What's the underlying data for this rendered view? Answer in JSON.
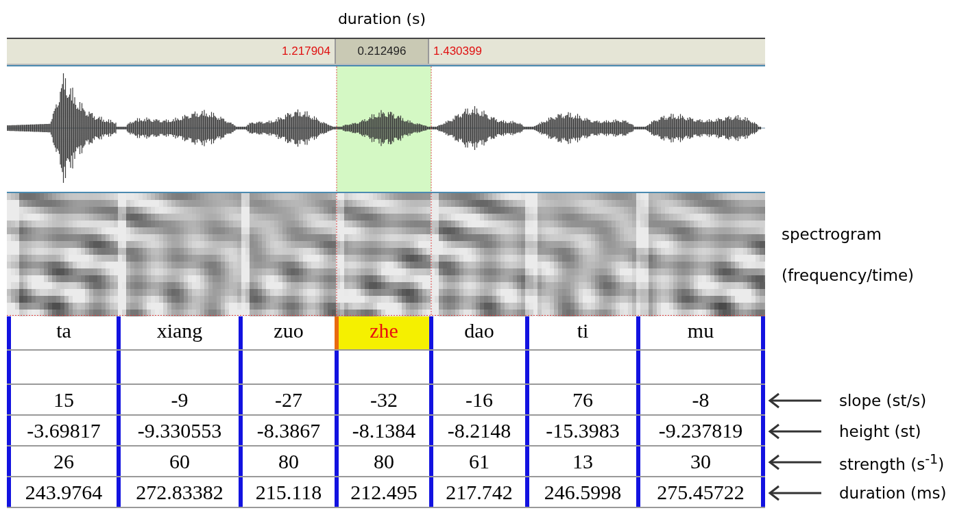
{
  "title": "duration (s)",
  "time_bar": {
    "start": "1.217904",
    "duration": "0.212496",
    "end": "1.430399"
  },
  "spectrogram_caption": [
    "spectrogram",
    "(frequency/time)"
  ],
  "intervals": [
    {
      "label": "ta",
      "selected": false
    },
    {
      "label": "xiang",
      "selected": false
    },
    {
      "label": "zuo",
      "selected": false
    },
    {
      "label": "zhe",
      "selected": true
    },
    {
      "label": "dao",
      "selected": false
    },
    {
      "label": "ti",
      "selected": false
    },
    {
      "label": "mu",
      "selected": false
    }
  ],
  "tiers": [
    {
      "annotation": "slope (st/s)",
      "values": [
        "15",
        "-9",
        "-27",
        "-32",
        "-16",
        "76",
        "-8"
      ]
    },
    {
      "annotation": "height (st)",
      "values": [
        "-3.69817",
        "-9.330553",
        "-8.3867",
        "-8.1384",
        "-8.2148",
        "-15.3983",
        "-9.237819"
      ]
    },
    {
      "annotation": "strength (s$^{-1}$)",
      "values": [
        "26",
        "60",
        "80",
        "80",
        "61",
        "13",
        "30"
      ]
    },
    {
      "annotation": "duration (ms)",
      "values": [
        "243.9764",
        "272.83382",
        "215.118",
        "212.495",
        "217.742",
        "246.5998",
        "275.45722"
      ]
    }
  ]
}
